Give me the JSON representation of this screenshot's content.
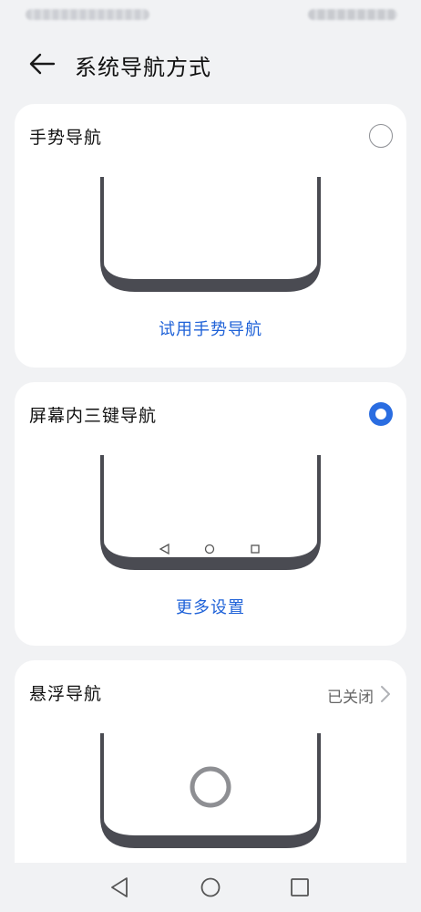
{
  "header": {
    "title": "系统导航方式"
  },
  "cards": [
    {
      "title": "手势导航",
      "selected": false,
      "action": "试用手势导航"
    },
    {
      "title": "屏幕内三键导航",
      "selected": true,
      "action": "更多设置"
    },
    {
      "title": "悬浮导航",
      "status": "已关闭"
    }
  ],
  "icons": {
    "back": "arrow-left-icon",
    "radio_off": "radio-unchecked-icon",
    "radio_on": "radio-checked-icon",
    "chevron": "chevron-right-icon",
    "nav_back": "triangle-back-icon",
    "nav_home": "circle-home-icon",
    "nav_recent": "square-recent-icon"
  },
  "colors": {
    "accent": "#1f62d8",
    "radio_selected": "#2a6de1",
    "background": "#f1f2f4",
    "card": "#ffffff",
    "phone_frame": "#4a4b52"
  }
}
